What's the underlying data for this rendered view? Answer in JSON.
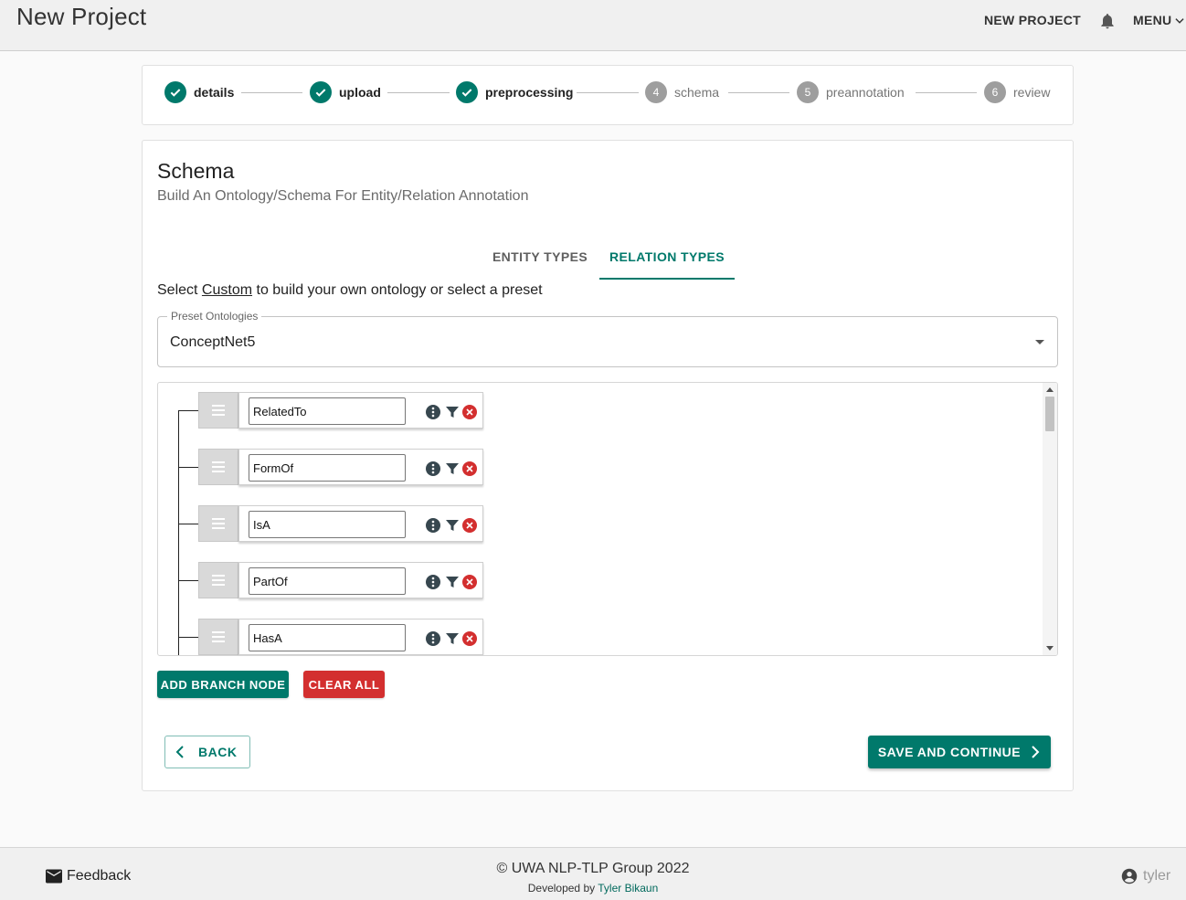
{
  "header": {
    "title": "New Project",
    "new_project_label": "NEW PROJECT",
    "menu_label": "MENU"
  },
  "stepper": {
    "steps": [
      {
        "number": "1",
        "label": "details",
        "status": "complete"
      },
      {
        "number": "2",
        "label": "upload",
        "status": "complete"
      },
      {
        "number": "3",
        "label": "preprocessing",
        "status": "complete"
      },
      {
        "number": "4",
        "label": "schema",
        "status": "pending"
      },
      {
        "number": "5",
        "label": "preannotation",
        "status": "pending"
      },
      {
        "number": "6",
        "label": "review",
        "status": "pending"
      }
    ]
  },
  "schema": {
    "title": "Schema",
    "subtitle": "Build An Ontology/Schema For Entity/Relation Annotation",
    "tabs": [
      {
        "label": "ENTITY TYPES",
        "active": false
      },
      {
        "label": "RELATION TYPES",
        "active": true
      }
    ],
    "instruction": {
      "prefix": "Select ",
      "link": "Custom",
      "suffix": " to build your own ontology or select a preset"
    },
    "preset": {
      "legend": "Preset Ontologies",
      "value": "ConceptNet5"
    },
    "nodes": [
      {
        "name": "RelatedTo"
      },
      {
        "name": "FormOf"
      },
      {
        "name": "IsA"
      },
      {
        "name": "PartOf"
      },
      {
        "name": "HasA"
      }
    ],
    "add_branch_label": "ADD BRANCH NODE",
    "clear_all_label": "CLEAR ALL",
    "back_label": "BACK",
    "save_label": "SAVE AND CONTINUE"
  },
  "footer": {
    "feedback_label": "Feedback",
    "copyright": "© UWA NLP-TLP Group 2022",
    "developed_prefix": "Developed by ",
    "developer": "Tyler Bikaun",
    "username": "tyler"
  },
  "colors": {
    "primary": "#00796b",
    "danger": "#d32f2f",
    "step_pending": "#9e9e9e"
  },
  "icons": {
    "bell": "bell-icon",
    "chevron_down": "chevron-down-icon",
    "check": "check-icon",
    "drag": "drag-handle-icon",
    "info": "info-icon",
    "filter": "filter-icon",
    "remove": "remove-icon",
    "back": "chevron-left-icon",
    "forward": "chevron-right-icon",
    "mail": "mail-icon",
    "account": "account-circle-icon"
  }
}
